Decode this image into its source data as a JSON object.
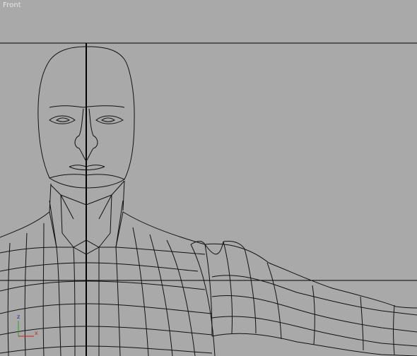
{
  "viewport": {
    "label": "Front",
    "background_color": "#a9a9a9",
    "wire_color": "#111111",
    "guide_color": "#000000"
  },
  "axis_gizmo": {
    "vertical_label": "z",
    "horizontal_label": "x",
    "vertical_color": "#2aa12a",
    "horizontal_color": "#d02020",
    "vertical_label_color": "#1a2aa0",
    "horizontal_label_color": "#d02020"
  }
}
